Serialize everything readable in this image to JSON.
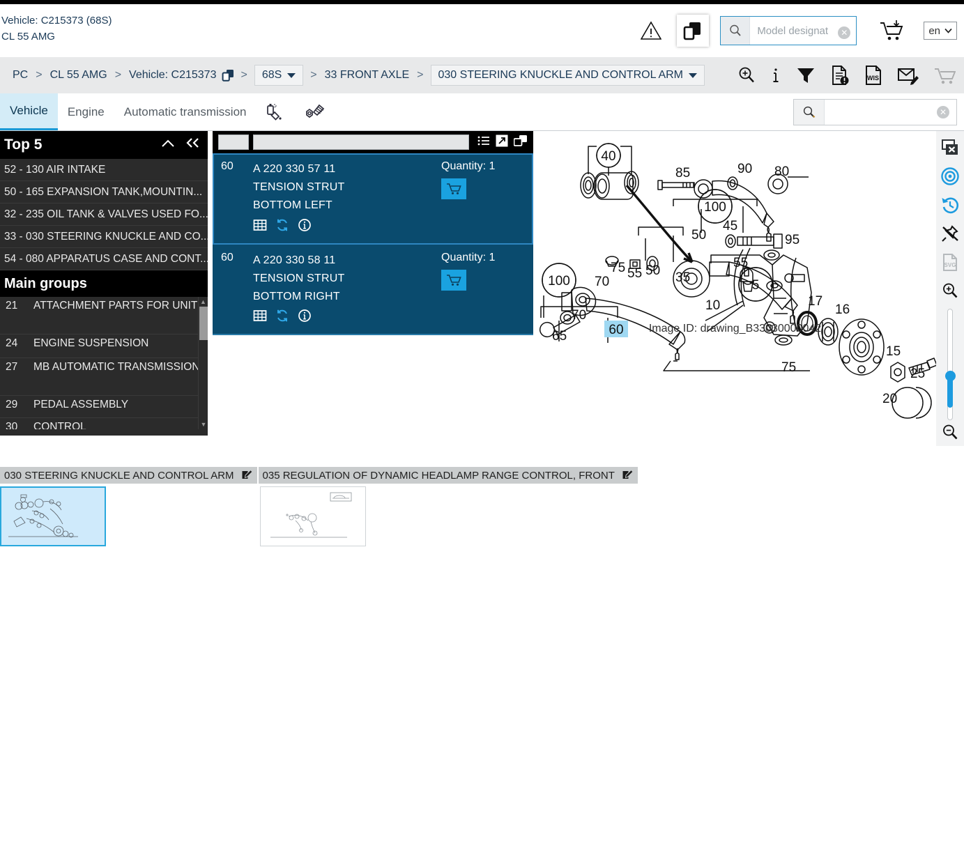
{
  "header": {
    "vehicle_line": "Vehicle: C215373 (68S)",
    "model_line": "CL 55 AMG",
    "warning_icon": "warning-triangle-icon",
    "copy_icon": "copy-documents-icon",
    "model_search_placeholder": "Model designat",
    "model_search_value": "",
    "cart_icon": "add-to-cart-icon",
    "language": "en"
  },
  "breadcrumb": {
    "items": [
      {
        "label": "PC",
        "type": "link"
      },
      {
        "label": "CL 55 AMG",
        "type": "link"
      },
      {
        "label": "Vehicle: C215373",
        "type": "link-with-icon",
        "icon": "copy-icon"
      },
      {
        "label": "68S",
        "type": "dropdown"
      },
      {
        "label": "33 FRONT AXLE",
        "type": "link"
      },
      {
        "label": "030 STEERING KNUCKLE AND CONTROL ARM",
        "type": "dropdown"
      }
    ],
    "separator": ">",
    "tools": [
      {
        "name": "zoom-in-search-icon"
      },
      {
        "name": "info-icon"
      },
      {
        "name": "filter-icon"
      },
      {
        "name": "document-alert-icon"
      },
      {
        "name": "wis-document-icon",
        "label": "WIS"
      },
      {
        "name": "mail-edit-icon"
      },
      {
        "name": "shopping-cart-icon"
      }
    ]
  },
  "tabs": {
    "items": [
      {
        "label": "Vehicle",
        "active": true
      },
      {
        "label": "Engine",
        "active": false
      },
      {
        "label": "Automatic transmission",
        "active": false
      }
    ],
    "icon_tabs": [
      {
        "name": "paint-spray-icon"
      },
      {
        "name": "bolt-nut-icon"
      }
    ],
    "search": {
      "value": "",
      "placeholder": ""
    }
  },
  "sidebar": {
    "top5": {
      "title": "Top 5",
      "collapse_icon": "chevron-up-icon",
      "collapse_all_icon": "double-chevron-left-icon",
      "items": [
        "52 - 130 AIR INTAKE",
        "50 - 165 EXPANSION TANK,MOUNTIN...",
        "32 - 235 OIL TANK & VALVES USED FO...",
        "33 - 030 STEERING KNUCKLE AND CO...",
        "54 - 080 APPARATUS CASE AND CONT..."
      ]
    },
    "main_groups": {
      "title": "Main groups",
      "items": [
        {
          "num": "21",
          "label": "ATTACHMENT PARTS FOR UNITS",
          "tall": true
        },
        {
          "num": "24",
          "label": "ENGINE SUSPENSION",
          "tall": false
        },
        {
          "num": "27",
          "label": "MB AUTOMATIC TRANSMISSION",
          "tall": true
        },
        {
          "num": "29",
          "label": "PEDAL ASSEMBLY",
          "tall": false
        },
        {
          "num": "30",
          "label": "CONTROL",
          "tall": false
        }
      ]
    }
  },
  "parts_panel": {
    "header": {
      "pos_filter": "",
      "text_filter": "",
      "icons": [
        {
          "name": "list-view-icon"
        },
        {
          "name": "expand-diagonal-icon"
        },
        {
          "name": "duplicate-window-icon"
        }
      ]
    },
    "rows": [
      {
        "pos": "60",
        "part_number": "A 220 330 57 11",
        "name": "TENSION STRUT",
        "detail": "BOTTOM LEFT",
        "quantity_label": "Quantity: 1",
        "row_icons": [
          {
            "name": "table-grid-icon"
          },
          {
            "name": "refresh-supersession-icon"
          },
          {
            "name": "info-circle-icon"
          }
        ],
        "cart_icon": "cart-icon"
      },
      {
        "pos": "60",
        "part_number": "A 220 330 58 11",
        "name": "TENSION STRUT",
        "detail": "BOTTOM RIGHT",
        "quantity_label": "Quantity: 1",
        "row_icons": [
          {
            "name": "table-grid-icon"
          },
          {
            "name": "refresh-supersession-icon"
          },
          {
            "name": "info-circle-icon"
          }
        ],
        "cart_icon": "cart-icon"
      }
    ]
  },
  "drawing": {
    "image_id_label": "Image ID: drawing_B33030000042",
    "highlighted_callout": "60",
    "callouts": [
      "40",
      "85",
      "90",
      "80",
      "100",
      "45",
      "95",
      "50",
      "55",
      "35",
      "75",
      "70",
      "100",
      "65",
      "60",
      "10",
      "5",
      "17",
      "16",
      "15",
      "25",
      "20"
    ]
  },
  "view_tools": [
    {
      "name": "close-window-icon"
    },
    {
      "name": "target-focus-icon"
    },
    {
      "name": "history-reset-icon"
    },
    {
      "name": "unpin-icon"
    },
    {
      "name": "svg-export-icon",
      "label": "SVG",
      "disabled": true
    },
    {
      "name": "zoom-in-icon"
    },
    {
      "name": "zoom-slider",
      "value": 28
    },
    {
      "name": "zoom-out-icon"
    }
  ],
  "thumbnails": [
    {
      "caption": "030 STEERING KNUCKLE AND CONTROL ARM",
      "edit_icon": "edit-note-icon",
      "selected": true
    },
    {
      "caption": "035 REGULATION OF DYNAMIC HEADLAMP RANGE CONTROL, FRONT",
      "edit_icon": "edit-note-icon",
      "selected": false
    }
  ],
  "colors": {
    "accent_blue": "#1aa2e0",
    "panel_dark": "#0a4b6e",
    "sidebar_dark": "#2b2b2b",
    "breadcrumb_bg": "#e8e9ea",
    "tab_active_bg": "#d4ecf7",
    "highlight": "#9fd8f2"
  }
}
